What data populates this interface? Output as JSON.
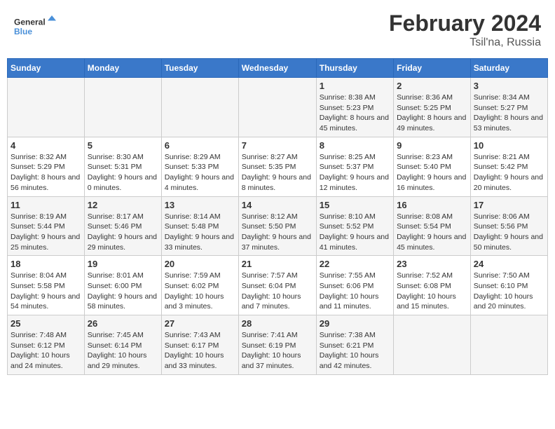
{
  "header": {
    "logo_line1": "General",
    "logo_line2": "Blue",
    "main_title": "February 2024",
    "sub_title": "Tsil'na, Russia"
  },
  "weekdays": [
    "Sunday",
    "Monday",
    "Tuesday",
    "Wednesday",
    "Thursday",
    "Friday",
    "Saturday"
  ],
  "weeks": [
    [
      {
        "day": "",
        "info": ""
      },
      {
        "day": "",
        "info": ""
      },
      {
        "day": "",
        "info": ""
      },
      {
        "day": "",
        "info": ""
      },
      {
        "day": "1",
        "info": "Sunrise: 8:38 AM\nSunset: 5:23 PM\nDaylight: 8 hours\nand 45 minutes."
      },
      {
        "day": "2",
        "info": "Sunrise: 8:36 AM\nSunset: 5:25 PM\nDaylight: 8 hours\nand 49 minutes."
      },
      {
        "day": "3",
        "info": "Sunrise: 8:34 AM\nSunset: 5:27 PM\nDaylight: 8 hours\nand 53 minutes."
      }
    ],
    [
      {
        "day": "4",
        "info": "Sunrise: 8:32 AM\nSunset: 5:29 PM\nDaylight: 8 hours\nand 56 minutes."
      },
      {
        "day": "5",
        "info": "Sunrise: 8:30 AM\nSunset: 5:31 PM\nDaylight: 9 hours\nand 0 minutes."
      },
      {
        "day": "6",
        "info": "Sunrise: 8:29 AM\nSunset: 5:33 PM\nDaylight: 9 hours\nand 4 minutes."
      },
      {
        "day": "7",
        "info": "Sunrise: 8:27 AM\nSunset: 5:35 PM\nDaylight: 9 hours\nand 8 minutes."
      },
      {
        "day": "8",
        "info": "Sunrise: 8:25 AM\nSunset: 5:37 PM\nDaylight: 9 hours\nand 12 minutes."
      },
      {
        "day": "9",
        "info": "Sunrise: 8:23 AM\nSunset: 5:40 PM\nDaylight: 9 hours\nand 16 minutes."
      },
      {
        "day": "10",
        "info": "Sunrise: 8:21 AM\nSunset: 5:42 PM\nDaylight: 9 hours\nand 20 minutes."
      }
    ],
    [
      {
        "day": "11",
        "info": "Sunrise: 8:19 AM\nSunset: 5:44 PM\nDaylight: 9 hours\nand 25 minutes."
      },
      {
        "day": "12",
        "info": "Sunrise: 8:17 AM\nSunset: 5:46 PM\nDaylight: 9 hours\nand 29 minutes."
      },
      {
        "day": "13",
        "info": "Sunrise: 8:14 AM\nSunset: 5:48 PM\nDaylight: 9 hours\nand 33 minutes."
      },
      {
        "day": "14",
        "info": "Sunrise: 8:12 AM\nSunset: 5:50 PM\nDaylight: 9 hours\nand 37 minutes."
      },
      {
        "day": "15",
        "info": "Sunrise: 8:10 AM\nSunset: 5:52 PM\nDaylight: 9 hours\nand 41 minutes."
      },
      {
        "day": "16",
        "info": "Sunrise: 8:08 AM\nSunset: 5:54 PM\nDaylight: 9 hours\nand 45 minutes."
      },
      {
        "day": "17",
        "info": "Sunrise: 8:06 AM\nSunset: 5:56 PM\nDaylight: 9 hours\nand 50 minutes."
      }
    ],
    [
      {
        "day": "18",
        "info": "Sunrise: 8:04 AM\nSunset: 5:58 PM\nDaylight: 9 hours\nand 54 minutes."
      },
      {
        "day": "19",
        "info": "Sunrise: 8:01 AM\nSunset: 6:00 PM\nDaylight: 9 hours\nand 58 minutes."
      },
      {
        "day": "20",
        "info": "Sunrise: 7:59 AM\nSunset: 6:02 PM\nDaylight: 10 hours\nand 3 minutes."
      },
      {
        "day": "21",
        "info": "Sunrise: 7:57 AM\nSunset: 6:04 PM\nDaylight: 10 hours\nand 7 minutes."
      },
      {
        "day": "22",
        "info": "Sunrise: 7:55 AM\nSunset: 6:06 PM\nDaylight: 10 hours\nand 11 minutes."
      },
      {
        "day": "23",
        "info": "Sunrise: 7:52 AM\nSunset: 6:08 PM\nDaylight: 10 hours\nand 15 minutes."
      },
      {
        "day": "24",
        "info": "Sunrise: 7:50 AM\nSunset: 6:10 PM\nDaylight: 10 hours\nand 20 minutes."
      }
    ],
    [
      {
        "day": "25",
        "info": "Sunrise: 7:48 AM\nSunset: 6:12 PM\nDaylight: 10 hours\nand 24 minutes."
      },
      {
        "day": "26",
        "info": "Sunrise: 7:45 AM\nSunset: 6:14 PM\nDaylight: 10 hours\nand 29 minutes."
      },
      {
        "day": "27",
        "info": "Sunrise: 7:43 AM\nSunset: 6:17 PM\nDaylight: 10 hours\nand 33 minutes."
      },
      {
        "day": "28",
        "info": "Sunrise: 7:41 AM\nSunset: 6:19 PM\nDaylight: 10 hours\nand 37 minutes."
      },
      {
        "day": "29",
        "info": "Sunrise: 7:38 AM\nSunset: 6:21 PM\nDaylight: 10 hours\nand 42 minutes."
      },
      {
        "day": "",
        "info": ""
      },
      {
        "day": "",
        "info": ""
      }
    ]
  ]
}
